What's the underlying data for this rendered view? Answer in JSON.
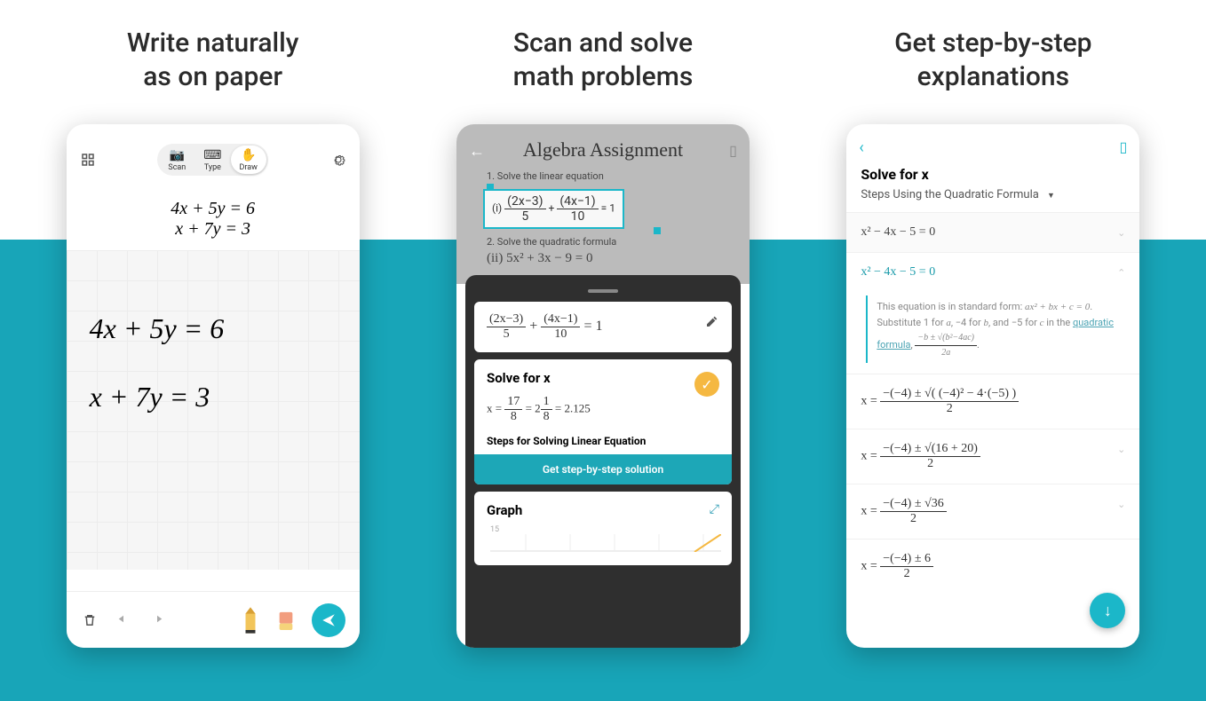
{
  "headlines": {
    "c1a": "Write naturally",
    "c1b": "as on paper",
    "c2a": "Scan and solve",
    "c2b": "math problems",
    "c3a": "Get step-by-step",
    "c3b": "explanations"
  },
  "p1": {
    "modes": {
      "scan": "Scan",
      "type": "Type",
      "draw": "Draw"
    },
    "formula_line1": "4x + 5y = 6",
    "formula_line2": "x + 7y = 3",
    "hand_line1": "4x + 5y = 6",
    "hand_line2": "x  + 7y = 3"
  },
  "p2": {
    "doc_title": "Algebra Assignment",
    "task1": "1. Solve the linear equation",
    "task1_label": "(i)",
    "eq_lhs_n1": "(2x−3)",
    "eq_lhs_d1": "5",
    "eq_plus": "+",
    "eq_lhs_n2": "(4x−1)",
    "eq_lhs_d2": "10",
    "eq_rhs": "= 1",
    "task2": "2. Solve the quadratic formula",
    "task2_eq": "5x² + 3x − 9 = 0",
    "task2_label": "(ii)",
    "solve_heading": "Solve for x",
    "solve_value_a": "17",
    "solve_value_b": "8",
    "solve_value_c": "2",
    "solve_value_d": "1",
    "solve_value_e": "8",
    "solve_value_decimal": "= 2.125",
    "steps_heading": "Steps for Solving Linear Equation",
    "get_solution": "Get step-by-step solution",
    "graph_heading": "Graph",
    "graph_tick": "15"
  },
  "p3": {
    "title": "Solve for x",
    "method": "Steps Using the Quadratic Formula",
    "row1": "x² − 4x − 5 = 0",
    "row2": "x² − 4x − 5 = 0",
    "explain_a": "This equation is in standard form: ",
    "explain_std": "ax² + bx + c = 0",
    "explain_b": ". Substitute 1 for ",
    "explain_b_a": "a",
    "explain_c": ", −4 for ",
    "explain_c_b": "b",
    "explain_d": ", and −5 for ",
    "explain_d_c": "c",
    "explain_e": " in the ",
    "explain_link": "quadratic formula",
    "explain_tail": ", ",
    "explain_qf_num": "−b ± √(b²−4ac)",
    "explain_qf_den": "2a",
    "explain_period": ".",
    "r3_pre": "x = ",
    "r3_num": "−(−4) ± √( (−4)² − 4·(−5) )",
    "r3_den": "2",
    "r4_pre": "x = ",
    "r4_num": "−(−4) ± √(16 + 20)",
    "r4_den": "2",
    "r5_pre": "x = ",
    "r5_num": "−(−4) ± √36",
    "r5_den": "2",
    "r6_pre": "x = ",
    "r6_num": "−(−4) ± 6",
    "r6_den": "2"
  }
}
